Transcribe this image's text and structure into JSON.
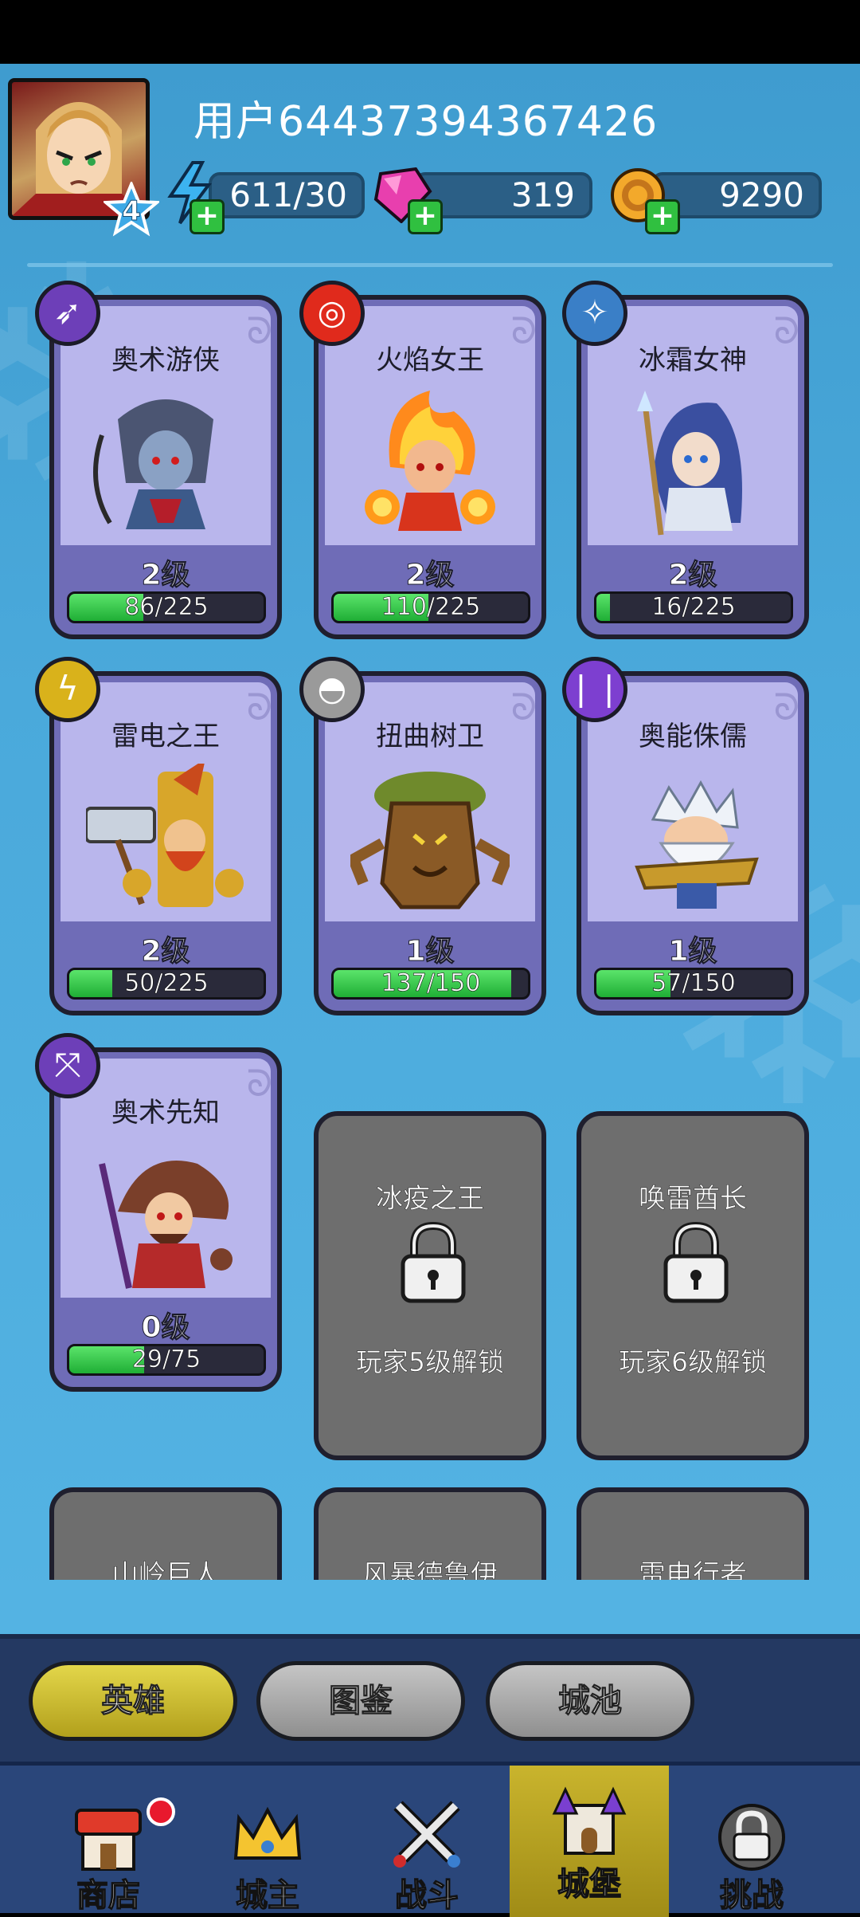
{
  "header": {
    "username": "用户64437394367426",
    "player_level": "4",
    "energy": "611/30",
    "gems": "319",
    "gold": "9290"
  },
  "heroes": [
    {
      "name": "奥术游侠",
      "level": "2级",
      "progress": "86/225",
      "fraction": 0.382
    },
    {
      "name": "火焰女王",
      "level": "2级",
      "progress": "110/225",
      "fraction": 0.489
    },
    {
      "name": "冰霜女神",
      "level": "2级",
      "progress": "16/225",
      "fraction": 0.071
    },
    {
      "name": "雷电之王",
      "level": "2级",
      "progress": "50/225",
      "fraction": 0.222
    },
    {
      "name": "扭曲树卫",
      "level": "1级",
      "progress": "137/150",
      "fraction": 0.913
    },
    {
      "name": "奥能侏儒",
      "level": "1级",
      "progress": "57/150",
      "fraction": 0.38
    },
    {
      "name": "奥术先知",
      "level": "0级",
      "progress": "29/75",
      "fraction": 0.387
    }
  ],
  "locked_heroes": [
    {
      "name": "冰疫之王",
      "unlock": "玩家5级解锁"
    },
    {
      "name": "唤雷酋长",
      "unlock": "玩家6级解锁"
    },
    {
      "name": "山岭巨人",
      "unlock": ""
    },
    {
      "name": "风暴德鲁伊",
      "unlock": ""
    },
    {
      "name": "雷电行者",
      "unlock": ""
    }
  ],
  "tabs": [
    "英雄",
    "图鉴",
    "城池"
  ],
  "nav": [
    "商店",
    "城主",
    "战斗",
    "城堡",
    "挑战"
  ],
  "colors": {
    "accent_yellow": "#c9b42d",
    "progress_green": "#1fae35",
    "card_purple": "#6f6cb7"
  }
}
